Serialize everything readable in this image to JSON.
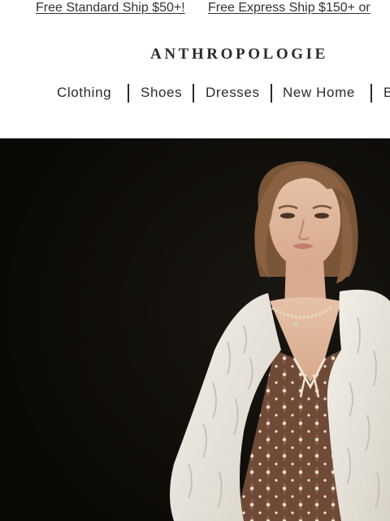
{
  "promo": {
    "standard_ship": "Free Standard Ship $50+!",
    "express_ship": "Free Express Ship $150+ or"
  },
  "header": {
    "logo_text": "ANTHROPOLOGIE"
  },
  "nav": {
    "items": [
      {
        "label": "Clothing"
      },
      {
        "label": "Shoes"
      },
      {
        "label": "Dresses"
      },
      {
        "label": "New Home"
      },
      {
        "label": "B"
      }
    ]
  },
  "hero": {
    "background_color": "#0d0b08"
  }
}
